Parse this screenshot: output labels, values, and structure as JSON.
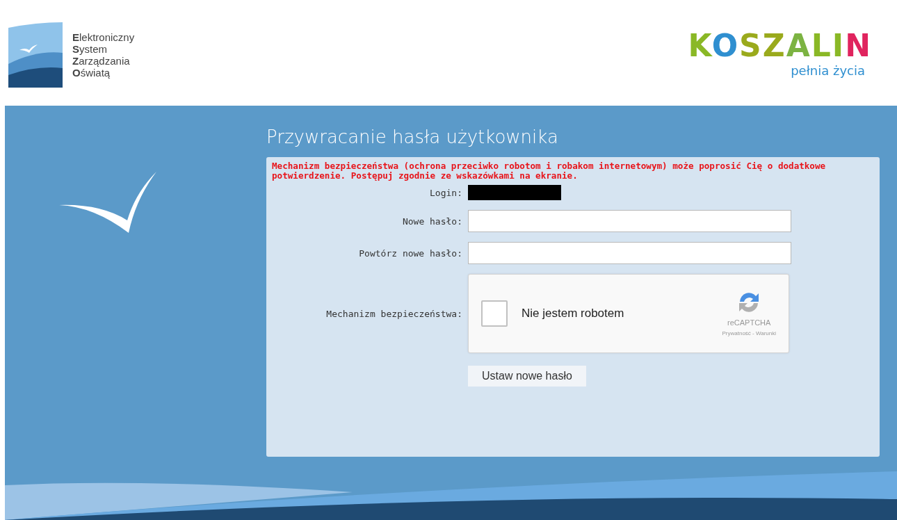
{
  "logo": {
    "lines": [
      "**E**lektroniczny",
      "**S**ystem",
      "**Z**arządzania",
      "**O**światą"
    ]
  },
  "city_logo": {
    "letters": [
      {
        "text": "K",
        "color": "#8ab826"
      },
      {
        "text": "O",
        "color": "#2f8fd0"
      },
      {
        "text": "SZ",
        "color": "#9aaa1c"
      },
      {
        "text": "A",
        "color": "#7cb342"
      },
      {
        "text": "LI",
        "color": "#8ab826"
      },
      {
        "text": "N",
        "color": "#e0245e"
      }
    ],
    "tagline": "pełnia życia"
  },
  "title": "Przywracanie hasła użytkownika",
  "notice": "Mechanizm bezpieczeństwa (ochrona przeciwko robotom i robakom internetowym) może poprosić Cię o dodatkowe potwierdzenie. Postępuj zgodnie ze wskazówkami na ekranie.",
  "form": {
    "login": {
      "label": "Login:",
      "value_redacted": true
    },
    "fields": [
      {
        "label": "Nowe hasło:"
      },
      {
        "label": "Powtórz nowe hasło:"
      }
    ],
    "captcha": {
      "label": "Mechanizm bezpieczeństwa:",
      "checked": false,
      "text": "Nie jestem robotem",
      "brand": "reCAPTCHA",
      "links": [
        "Prywatność",
        "Warunki"
      ],
      "link_separator": "-"
    },
    "submit": "Ustaw nowe hasło"
  }
}
